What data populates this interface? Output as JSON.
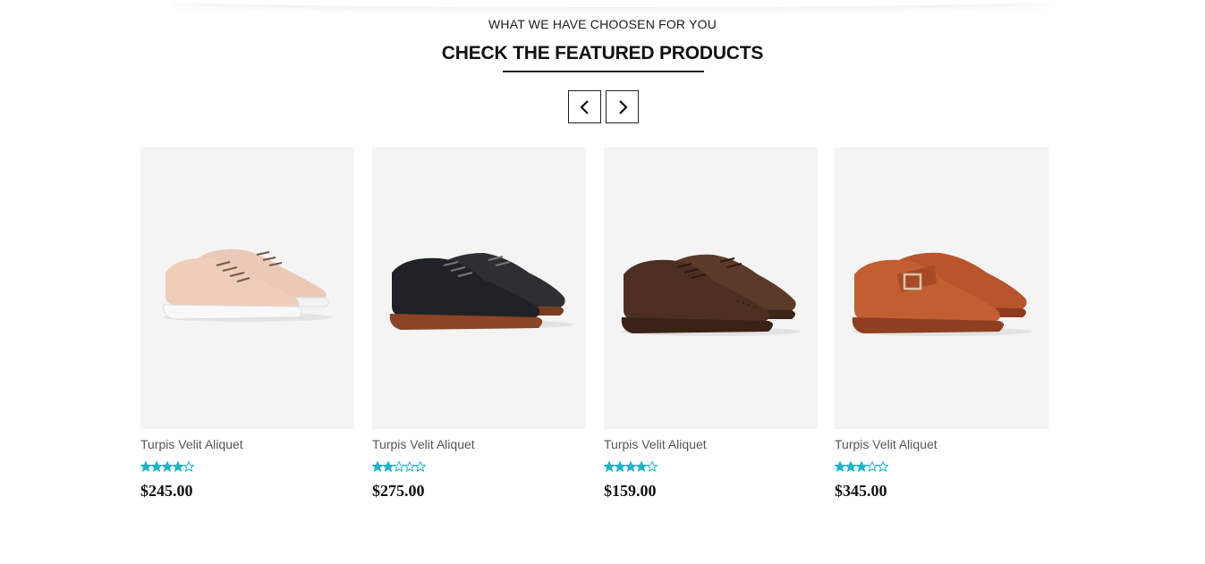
{
  "section": {
    "eyebrow": "WHAT WE HAVE CHOOSEN FOR YOU",
    "title": "CHECK THE FEATURED PRODUCTS"
  },
  "carousel": {
    "prev_icon": "chevron-left-icon",
    "next_icon": "chevron-right-icon"
  },
  "colors": {
    "star": "#1fb4c9",
    "image_bg": "#f4f4f4",
    "price": "#111111"
  },
  "products": [
    {
      "name": "Turpis Velit Aliquet",
      "rating": 4,
      "price": "$245.00",
      "image": "beige-sneaker"
    },
    {
      "name": "Turpis Velit Aliquet",
      "rating": 2,
      "price": "$275.00",
      "image": "black-derby-shoe"
    },
    {
      "name": "Turpis Velit Aliquet",
      "rating": 4,
      "price": "$159.00",
      "image": "brown-brogue-shoe"
    },
    {
      "name": "Turpis Velit Aliquet",
      "rating": 3,
      "price": "$345.00",
      "image": "tan-monk-strap-shoe"
    }
  ]
}
